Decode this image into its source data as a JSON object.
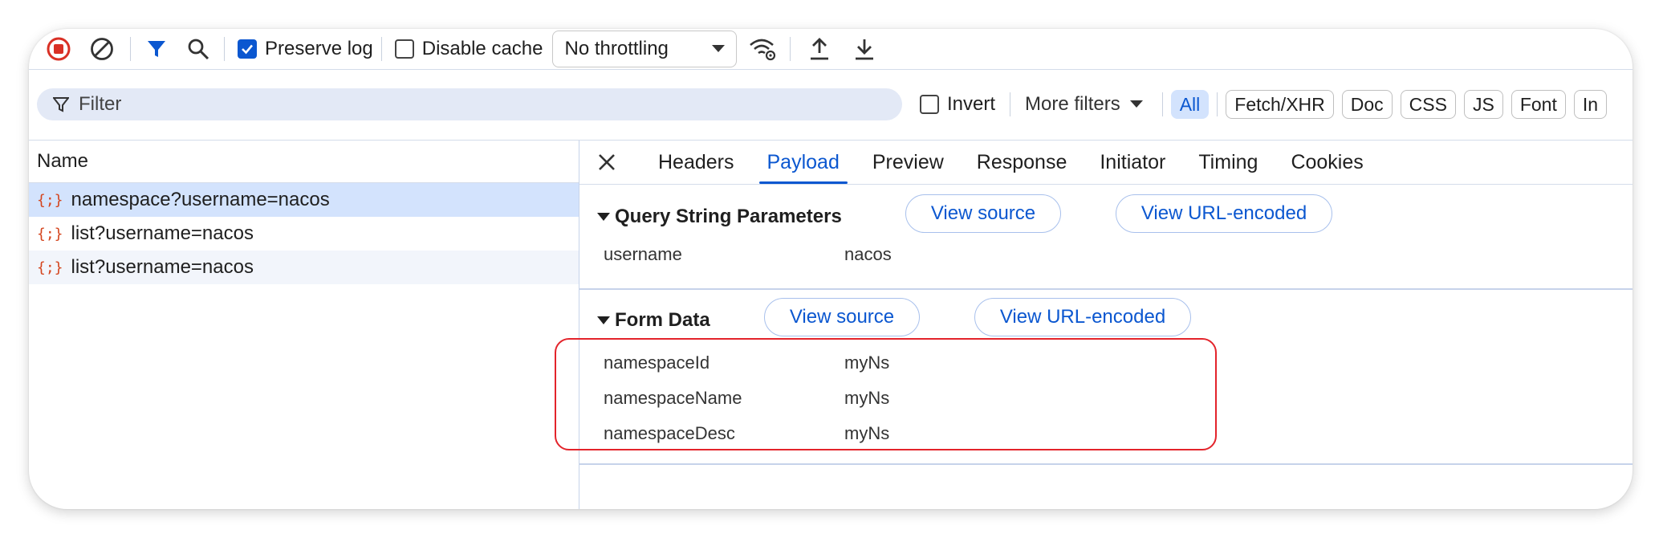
{
  "toolbar": {
    "preserve_log_label": "Preserve log",
    "preserve_log_checked": true,
    "disable_cache_label": "Disable cache",
    "disable_cache_checked": false,
    "throttling_value": "No throttling"
  },
  "filterbar": {
    "filter_placeholder": "Filter",
    "invert_label": "Invert",
    "more_filters_label": "More filters",
    "chips": [
      "All",
      "Fetch/XHR",
      "Doc",
      "CSS",
      "JS",
      "Font",
      "In"
    ],
    "active_chip": "All"
  },
  "requests": {
    "column_header": "Name",
    "items": [
      {
        "icon": "{;}",
        "name": "namespace?username=nacos"
      },
      {
        "icon": "{;}",
        "name": "list?username=nacos"
      },
      {
        "icon": "{;}",
        "name": "list?username=nacos"
      }
    ]
  },
  "details": {
    "tabs": [
      "Headers",
      "Payload",
      "Preview",
      "Response",
      "Initiator",
      "Timing",
      "Cookies"
    ],
    "active_tab": "Payload",
    "query": {
      "title": "Query String Parameters",
      "view_source": "View source",
      "view_url_encoded": "View URL-encoded",
      "params": [
        {
          "key": "username",
          "value": "nacos"
        }
      ]
    },
    "form": {
      "title": "Form Data",
      "view_source": "View source",
      "view_url_encoded": "View URL-encoded",
      "params": [
        {
          "key": "namespaceId",
          "value": "myNs"
        },
        {
          "key": "namespaceName",
          "value": "myNs"
        },
        {
          "key": "namespaceDesc",
          "value": "myNs"
        }
      ]
    }
  },
  "colors": {
    "accent": "#0b57d0",
    "record": "#d93025",
    "highlight": "#e3242b"
  }
}
